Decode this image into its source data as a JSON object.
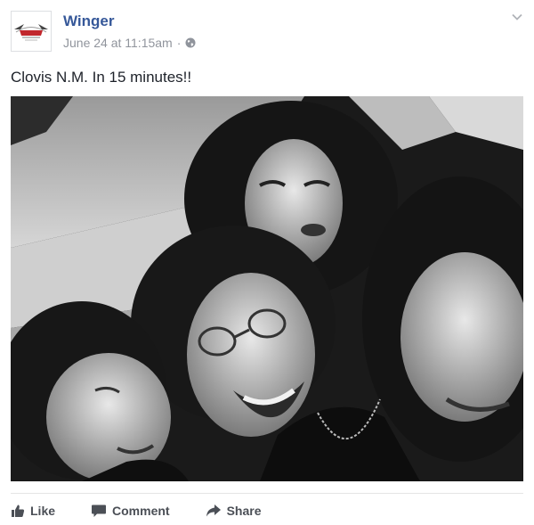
{
  "post": {
    "page_name": "Winger",
    "timestamp": "June 24 at 11:15am",
    "separator": "·",
    "privacy_icon": "globe-icon",
    "text": "Clovis N.M. In 15 minutes!!"
  },
  "avatar": {
    "logo_text": "Winger"
  },
  "actions": {
    "like_label": "Like",
    "comment_label": "Comment",
    "share_label": "Share"
  },
  "colors": {
    "link": "#365899",
    "meta": "#90949c",
    "text": "#1d2129",
    "action": "#4b4f56"
  }
}
